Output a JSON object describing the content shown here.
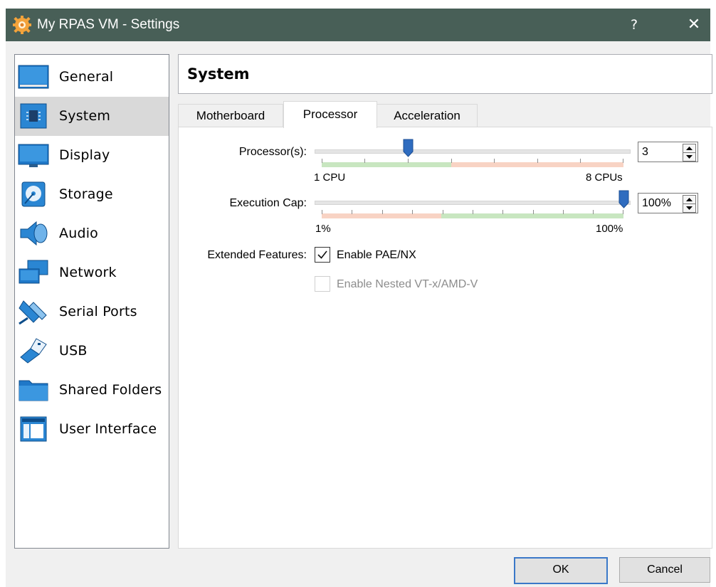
{
  "window": {
    "title": "My RPAS VM - Settings",
    "help_label": "?",
    "close_label": "✕"
  },
  "sidebar": {
    "items": [
      {
        "label": "General",
        "icon": "general-icon"
      },
      {
        "label": "System",
        "icon": "system-icon",
        "selected": true
      },
      {
        "label": "Display",
        "icon": "display-icon"
      },
      {
        "label": "Storage",
        "icon": "storage-icon"
      },
      {
        "label": "Audio",
        "icon": "audio-icon"
      },
      {
        "label": "Network",
        "icon": "network-icon"
      },
      {
        "label": "Serial Ports",
        "icon": "serial-ports-icon"
      },
      {
        "label": "USB",
        "icon": "usb-icon"
      },
      {
        "label": "Shared Folders",
        "icon": "shared-folders-icon"
      },
      {
        "label": "User Interface",
        "icon": "user-interface-icon"
      }
    ]
  },
  "page": {
    "heading": "System",
    "tabs": [
      {
        "label": "Motherboard"
      },
      {
        "label": "Processor",
        "active": true
      },
      {
        "label": "Acceleration"
      }
    ]
  },
  "processor": {
    "label": "Processor(s):",
    "value": "3",
    "fraction": 0.2857,
    "min_label": "1 CPU",
    "max_label": "8 CPUs"
  },
  "execution_cap": {
    "label": "Execution Cap:",
    "value": "100%",
    "fraction": 1.0,
    "min_label": "1%",
    "max_label": "100%"
  },
  "extended": {
    "label": "Extended Features:",
    "pae_label": "Enable PAE/NX",
    "pae_checked": true,
    "nested_label": "Enable Nested VT-x/AMD-V",
    "nested_checked": false,
    "nested_enabled": false
  },
  "buttons": {
    "ok": "OK",
    "cancel": "Cancel"
  },
  "colors": {
    "titlebar": "#485f57",
    "selected_item": "#d9d9d9",
    "slider_thumb": "#2f6cbf",
    "scale_green": "#c8e6c0",
    "scale_red": "#f8d3c4",
    "accent": "#3a78c8"
  }
}
